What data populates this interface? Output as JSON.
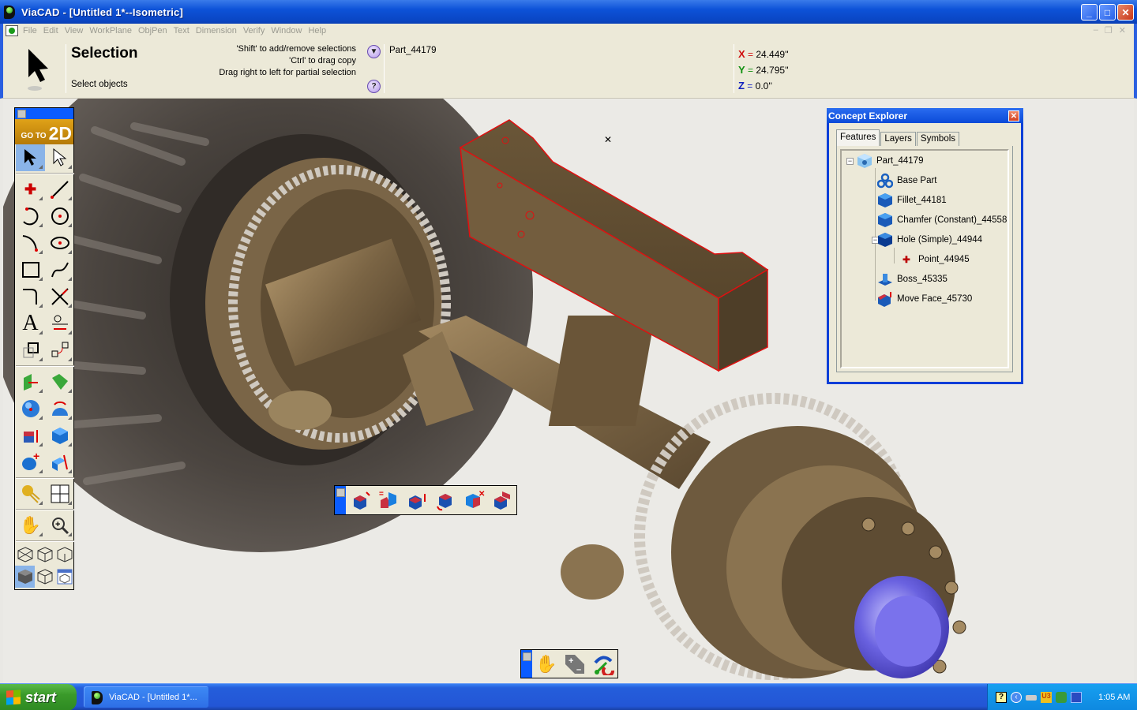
{
  "window": {
    "title": "ViaCAD - [Untitled 1*--Isometric]",
    "buttons": [
      "minimize",
      "maximize",
      "close"
    ]
  },
  "menubar": {
    "items": [
      "File",
      "Edit",
      "View",
      "WorkPlane",
      "ObjPen",
      "Text",
      "Dimension",
      "Verify",
      "Window",
      "Help"
    ]
  },
  "modebar": {
    "mode_title": "Selection",
    "mode_subtitle": "Select objects",
    "hints": [
      "'Shift' to add/remove selections",
      "'Ctrl' to drag copy",
      "Drag right to left for partial selection"
    ],
    "dropdown_icon": "chevron-down-icon",
    "help_icon": "help-icon",
    "help_glyph": "?",
    "selected_part": "Part_44179",
    "coordinates": {
      "x": {
        "label": "X",
        "value": "24.449''",
        "color": "#d01010"
      },
      "y": {
        "label": "Y",
        "value": "24.795''",
        "color": "#109010"
      },
      "z": {
        "label": "Z",
        "value": "0.0''",
        "color": "#1020c0"
      }
    }
  },
  "toolbox": {
    "goto_small": "GO TO",
    "goto_big": "2D",
    "tools": [
      "select",
      "select-subobject",
      "point",
      "line",
      "arc-3-point",
      "circle",
      "arc-tangent",
      "ellipse",
      "rectangle",
      "spline",
      "fillet-2d",
      "trim",
      "text",
      "dimension",
      "transform",
      "edit-points",
      "extrude",
      "loft",
      "sphere",
      "revolve",
      "shell-face",
      "solid-edit",
      "boolean-add",
      "section",
      "light",
      "viewports",
      "pan",
      "zoom",
      "iso-view",
      "view-front",
      "view-top",
      "shaded",
      "wireframe",
      "render-view"
    ]
  },
  "modify_toolbar": {
    "tools": [
      "move-face",
      "offset-face",
      "push-pull",
      "rotate-face",
      "delete-face",
      "replace-face"
    ]
  },
  "view_toolbar": {
    "tools": [
      "pan",
      "dynamic-zoom",
      "rotate-view"
    ]
  },
  "concept_explorer": {
    "title": "Concept Explorer",
    "tabs": [
      "Features",
      "Layers",
      "Symbols"
    ],
    "active_tab": "Features",
    "tree": {
      "root": {
        "label": "Part_44179",
        "icon": "part-icon",
        "expanded": true
      },
      "children": [
        {
          "label": "Base Part",
          "icon": "base-part-icon"
        },
        {
          "label": "Fillet_44181",
          "icon": "fillet-icon"
        },
        {
          "label": "Chamfer (Constant)_44558",
          "icon": "chamfer-icon"
        },
        {
          "label": "Hole (Simple)_44944",
          "icon": "hole-icon",
          "expanded": true,
          "children": [
            {
              "label": "Point_44945",
              "icon": "point-icon"
            }
          ]
        },
        {
          "label": "Boss_45335",
          "icon": "boss-icon"
        },
        {
          "label": "Move Face_45730",
          "icon": "move-face-icon"
        }
      ]
    }
  },
  "taskbar": {
    "start_label": "start",
    "task_label": "ViaCAD - [Untitled 1*...",
    "tray_icons": [
      "help-tray-icon",
      "show-hidden-icon",
      "drive-icon",
      "u3-icon",
      "network-safe-icon",
      "wireless-icon"
    ],
    "clock": "1:05 AM"
  },
  "colors": {
    "selection_highlight": "#e01010",
    "model_bronze": "#8a7350",
    "tire": "#4a4440",
    "hub_cap": "#6a62e0",
    "titlebar_blue": "#0d52d8",
    "panel_bg": "#ece9d8"
  }
}
